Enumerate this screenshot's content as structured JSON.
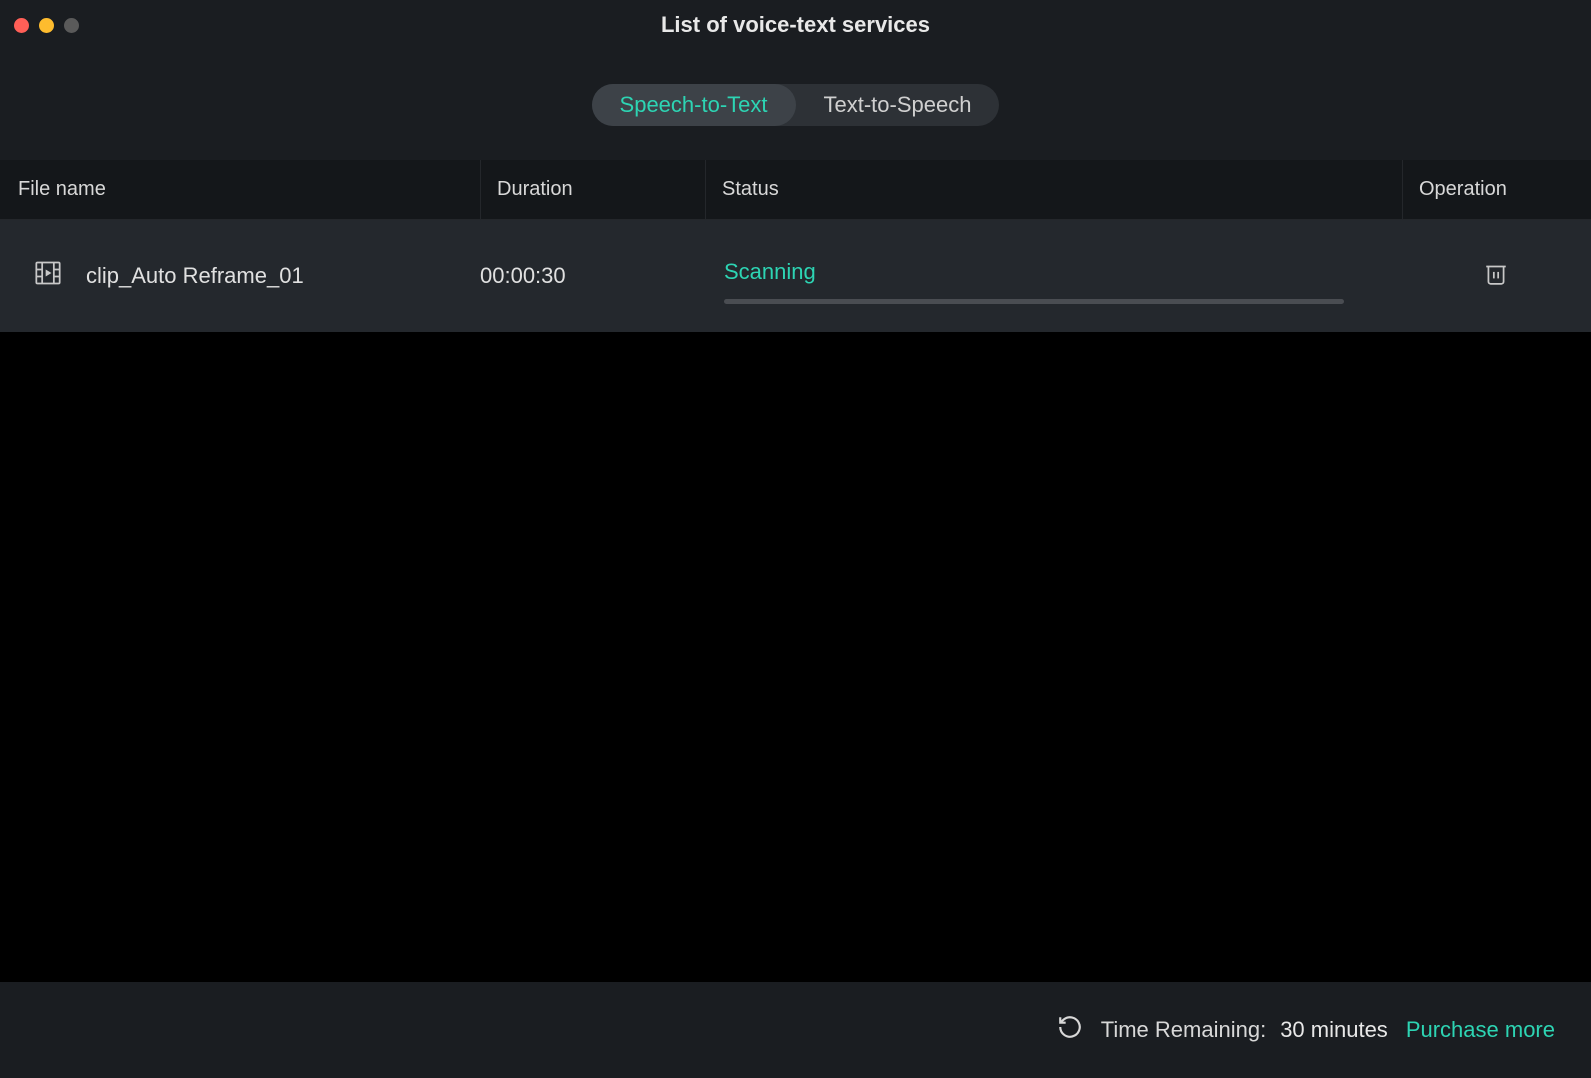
{
  "window": {
    "title": "List of voice-text services"
  },
  "tabs": {
    "speech_to_text": "Speech-to-Text",
    "text_to_speech": "Text-to-Speech"
  },
  "table": {
    "headers": {
      "file_name": "File name",
      "duration": "Duration",
      "status": "Status",
      "operation": "Operation"
    },
    "rows": [
      {
        "file_name": "clip_Auto Reframe_01",
        "duration": "00:00:30",
        "status": "Scanning"
      }
    ]
  },
  "footer": {
    "time_remaining_label": "Time Remaining:",
    "time_remaining_value": "30 minutes",
    "purchase_more": "Purchase more"
  }
}
